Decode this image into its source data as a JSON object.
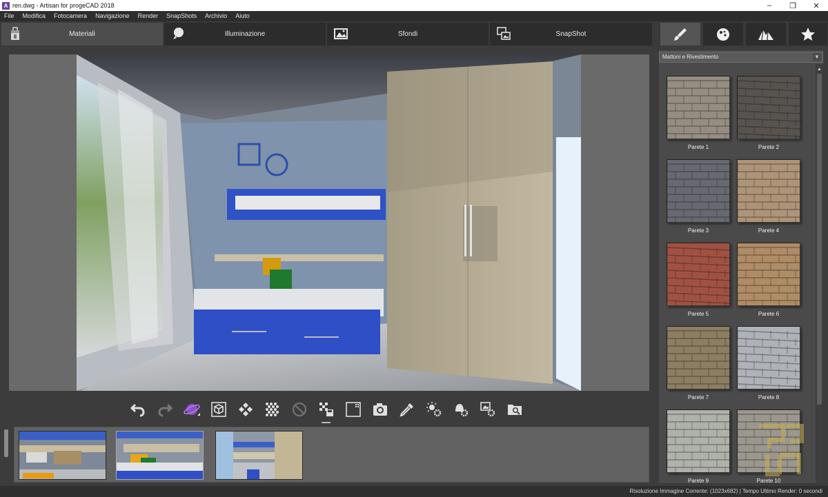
{
  "window": {
    "title": "ren.dwg - Artisan for progeCAD 2018",
    "app_icon_letter": "A",
    "minimize_glyph": "–",
    "maximize_glyph": "❐",
    "close_glyph": "✕"
  },
  "menu": [
    "File",
    "Modifica",
    "Fotocamera",
    "Navigazione",
    "Render",
    "SnapShots",
    "Archivio",
    "Aiuto"
  ],
  "tabs": [
    {
      "label": "Materiali",
      "icon": "paint-bucket-icon",
      "active": true
    },
    {
      "label": "Illuminazione",
      "icon": "lightbulb-icon",
      "active": false
    },
    {
      "label": "Sfondi",
      "icon": "background-image-icon",
      "active": false
    },
    {
      "label": "SnapShot",
      "icon": "snapshot-icon",
      "active": false
    }
  ],
  "icon_tabs": [
    {
      "icon": "brush-icon",
      "active": true
    },
    {
      "icon": "sphere-icon",
      "active": false
    },
    {
      "icon": "mountains-icon",
      "active": false
    },
    {
      "icon": "star-icon",
      "active": false
    }
  ],
  "toolbar": [
    "undo-icon",
    "redo-icon",
    "planet-icon",
    "cube-icon",
    "diamond-grid-icon",
    "dot-grid-icon",
    "disabled-icon",
    "checker-save-icon",
    "frame-icon",
    "camera-icon",
    "eyedropper-icon",
    "sun-settings-icon",
    "bell-settings-icon",
    "image-settings-icon",
    "folder-search-icon"
  ],
  "materials_panel": {
    "category": "Mattoni e Rivestimento",
    "scroll_up_glyph": "▲",
    "dropdown_glyph": "▼",
    "items": [
      {
        "label": "Parete 1",
        "color": "#8c8477"
      },
      {
        "label": "Parete 2",
        "color": "#4a4541"
      },
      {
        "label": "Parete 3",
        "color": "#5b5d66"
      },
      {
        "label": "Parete 4",
        "color": "#a88b6c"
      },
      {
        "label": "Parete 5",
        "color": "#9a4334"
      },
      {
        "label": "Parete 6",
        "color": "#a98358"
      },
      {
        "label": "Parete 7",
        "color": "#847355"
      },
      {
        "label": "Parete 8",
        "color": "#a9acb2"
      },
      {
        "label": "Parete 9",
        "color": "#a9aca3"
      },
      {
        "label": "Parete 10",
        "color": "#938f85"
      }
    ]
  },
  "status": {
    "resolution_label": "Risoluzione Immagine Corrente:",
    "resolution_value": "(1023x682)",
    "separator": "|",
    "render_time_label": "Tempo Ultimo Render:",
    "render_time_value": "0 secondi"
  }
}
